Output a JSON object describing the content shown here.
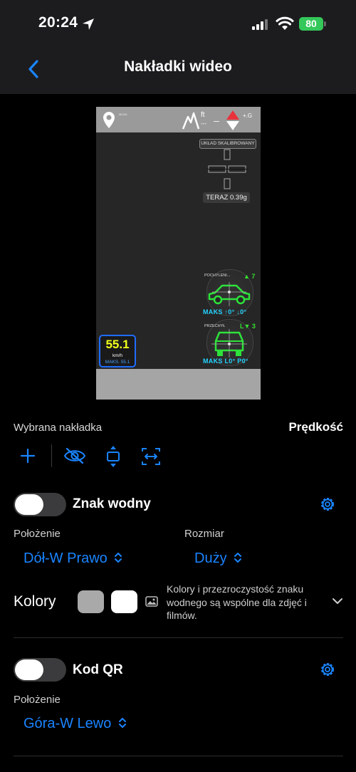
{
  "status": {
    "time": "20:24",
    "battery": "80"
  },
  "nav": {
    "title": "Nakładki wideo"
  },
  "preview": {
    "top_left_text": "MOZA",
    "altitude_unit": "ft",
    "altitude_value": "---",
    "gforce_unit": "+.G",
    "calibrated": "UKŁAD SKALIBROWANY",
    "now_label": "TERAZ 0.39g",
    "pitch_label": "POCHYLENI...",
    "pitch_count": "▲ 7",
    "pitch_max": "MAKS ↑0° ↓0°",
    "roll_label": "PRZECHYŁ",
    "roll_count": "L▼ 3",
    "roll_max": "MAKS L0° P0°",
    "speed_value": "55.1",
    "speed_unit": "km/h",
    "speed_max": "MAKS. 55.1"
  },
  "selected": {
    "label": "Wybrana nakładka",
    "value": "Prędkość"
  },
  "watermark": {
    "label": "Znak wodny",
    "enabled": false,
    "position_label": "Położenie",
    "position_value": "Dół-W Prawo",
    "size_label": "Rozmiar",
    "size_value": "Duży",
    "colors_label": "Kolory",
    "colors": [
      "#a9a9a9",
      "#ffffff"
    ],
    "note": "Kolory i przezroczystość znaku wodnego są wspólne dla zdjęć i filmów."
  },
  "qr": {
    "label": "Kod QR",
    "enabled": false,
    "position_label": "Położenie",
    "position_value": "Góra-W Lewo"
  },
  "colors": {
    "accent": "#1a84ff",
    "bar": "#1c1c1e",
    "battery": "#34c759"
  }
}
